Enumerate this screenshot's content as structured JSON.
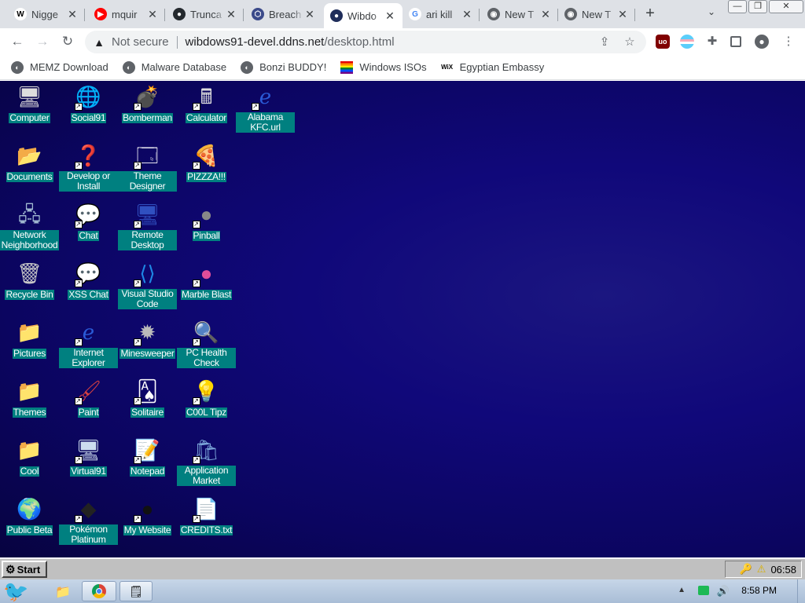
{
  "tabs": [
    {
      "title": "Nigge",
      "favicon": "W",
      "color": "#000000",
      "bg": "#ffffff"
    },
    {
      "title": "mquir",
      "favicon": "▶",
      "color": "#ffffff",
      "bg": "#ff0000"
    },
    {
      "title": "Trunca",
      "favicon": "●",
      "color": "#ffffff",
      "bg": "#24292e"
    },
    {
      "title": "Breach",
      "favicon": "⬡",
      "color": "#ffffff",
      "bg": "#3b4a8a"
    },
    {
      "title": "Wibdo",
      "favicon": "●",
      "color": "#ffffff",
      "bg": "#1f2d5a"
    },
    {
      "title": "ari kill",
      "favicon": "G",
      "color": "#4285f4",
      "bg": "#ffffff"
    },
    {
      "title": "New T",
      "favicon": "◉",
      "color": "#ffffff",
      "bg": "#5f6368"
    },
    {
      "title": "New T",
      "favicon": "◉",
      "color": "#ffffff",
      "bg": "#5f6368"
    }
  ],
  "omnibox": {
    "security": "Not secure",
    "url_host": "wibdows91-devel.ddns.net",
    "url_path": "/desktop.html"
  },
  "bookmarks": [
    {
      "label": "MEMZ Download",
      "icon": "globe-icon"
    },
    {
      "label": "Malware Database",
      "icon": "globe-icon"
    },
    {
      "label": "Bonzi BUDDY!",
      "icon": "bonzi-icon"
    },
    {
      "label": "Windows ISOs",
      "icon": "rainbow-flag-icon"
    },
    {
      "label": "Egyptian Embassy",
      "icon": "wix-icon"
    }
  ],
  "desktop_icons": [
    {
      "label": "Computer",
      "glyph": "🖥",
      "shortcut": false
    },
    {
      "label": "Documents",
      "glyph": "📂",
      "shortcut": false
    },
    {
      "label": "Network Neighborhood",
      "glyph": "🖧",
      "shortcut": false
    },
    {
      "label": "Recycle Bin",
      "glyph": "🗑",
      "shortcut": false
    },
    {
      "label": "Pictures",
      "glyph": "📁",
      "shortcut": false
    },
    {
      "label": "Themes",
      "glyph": "📁",
      "shortcut": false
    },
    {
      "label": "Cool",
      "glyph": "📁",
      "shortcut": false
    },
    {
      "label": "Public Beta",
      "glyph": "🌍",
      "shortcut": false
    },
    {
      "label": "Social91",
      "glyph": "🌐",
      "shortcut": true
    },
    {
      "label": "Develop or Install",
      "glyph": "❓",
      "shortcut": true
    },
    {
      "label": "Chat",
      "glyph": "💬",
      "shortcut": true
    },
    {
      "label": "XSS Chat",
      "glyph": "💬",
      "shortcut": true
    },
    {
      "label": "Internet Explorer",
      "glyph": "ℯ",
      "shortcut": true
    },
    {
      "label": "Paint",
      "glyph": "🖌",
      "shortcut": true
    },
    {
      "label": "Virtual91",
      "glyph": "🖥",
      "shortcut": true
    },
    {
      "label": "Pokémon Platinum",
      "glyph": "◆",
      "shortcut": true
    },
    {
      "label": "Bomberman",
      "glyph": "💣",
      "shortcut": true
    },
    {
      "label": "Theme Designer",
      "glyph": "🗔",
      "shortcut": true
    },
    {
      "label": "Remote Desktop",
      "glyph": "🖥",
      "shortcut": true
    },
    {
      "label": "Visual Studio Code",
      "glyph": "⟨⟩",
      "shortcut": true
    },
    {
      "label": "Minesweeper",
      "glyph": "✹",
      "shortcut": true
    },
    {
      "label": "Solitaire",
      "glyph": "🂡",
      "shortcut": true
    },
    {
      "label": "Notepad",
      "glyph": "📝",
      "shortcut": true
    },
    {
      "label": "My Website",
      "glyph": "●",
      "shortcut": true
    },
    {
      "label": "Calculator",
      "glyph": "🖩",
      "shortcut": true
    },
    {
      "label": "PIZZZA!!!",
      "glyph": "🍕",
      "shortcut": true
    },
    {
      "label": "Pinball",
      "glyph": "●",
      "shortcut": true
    },
    {
      "label": "Marble Blast",
      "glyph": "●",
      "shortcut": true
    },
    {
      "label": "PC Health Check",
      "glyph": "🔍",
      "shortcut": true
    },
    {
      "label": "C00L Tipz",
      "glyph": "💡",
      "shortcut": true
    },
    {
      "label": "Application Market",
      "glyph": "🛍",
      "shortcut": true
    },
    {
      "label": "CREDITS.txt",
      "glyph": "📄",
      "shortcut": true
    },
    {
      "label": "Alabama KFC.url",
      "glyph": "ℯ",
      "shortcut": true
    }
  ],
  "taskbar": {
    "start_label": "Start",
    "clock": "06:58"
  },
  "os_taskbar": {
    "clock": "8:58 PM"
  },
  "colors": {
    "desktop_label_bg": "#008080",
    "desktop_bg": "#10087a",
    "taskbar_bg": "#c0c0c0"
  }
}
